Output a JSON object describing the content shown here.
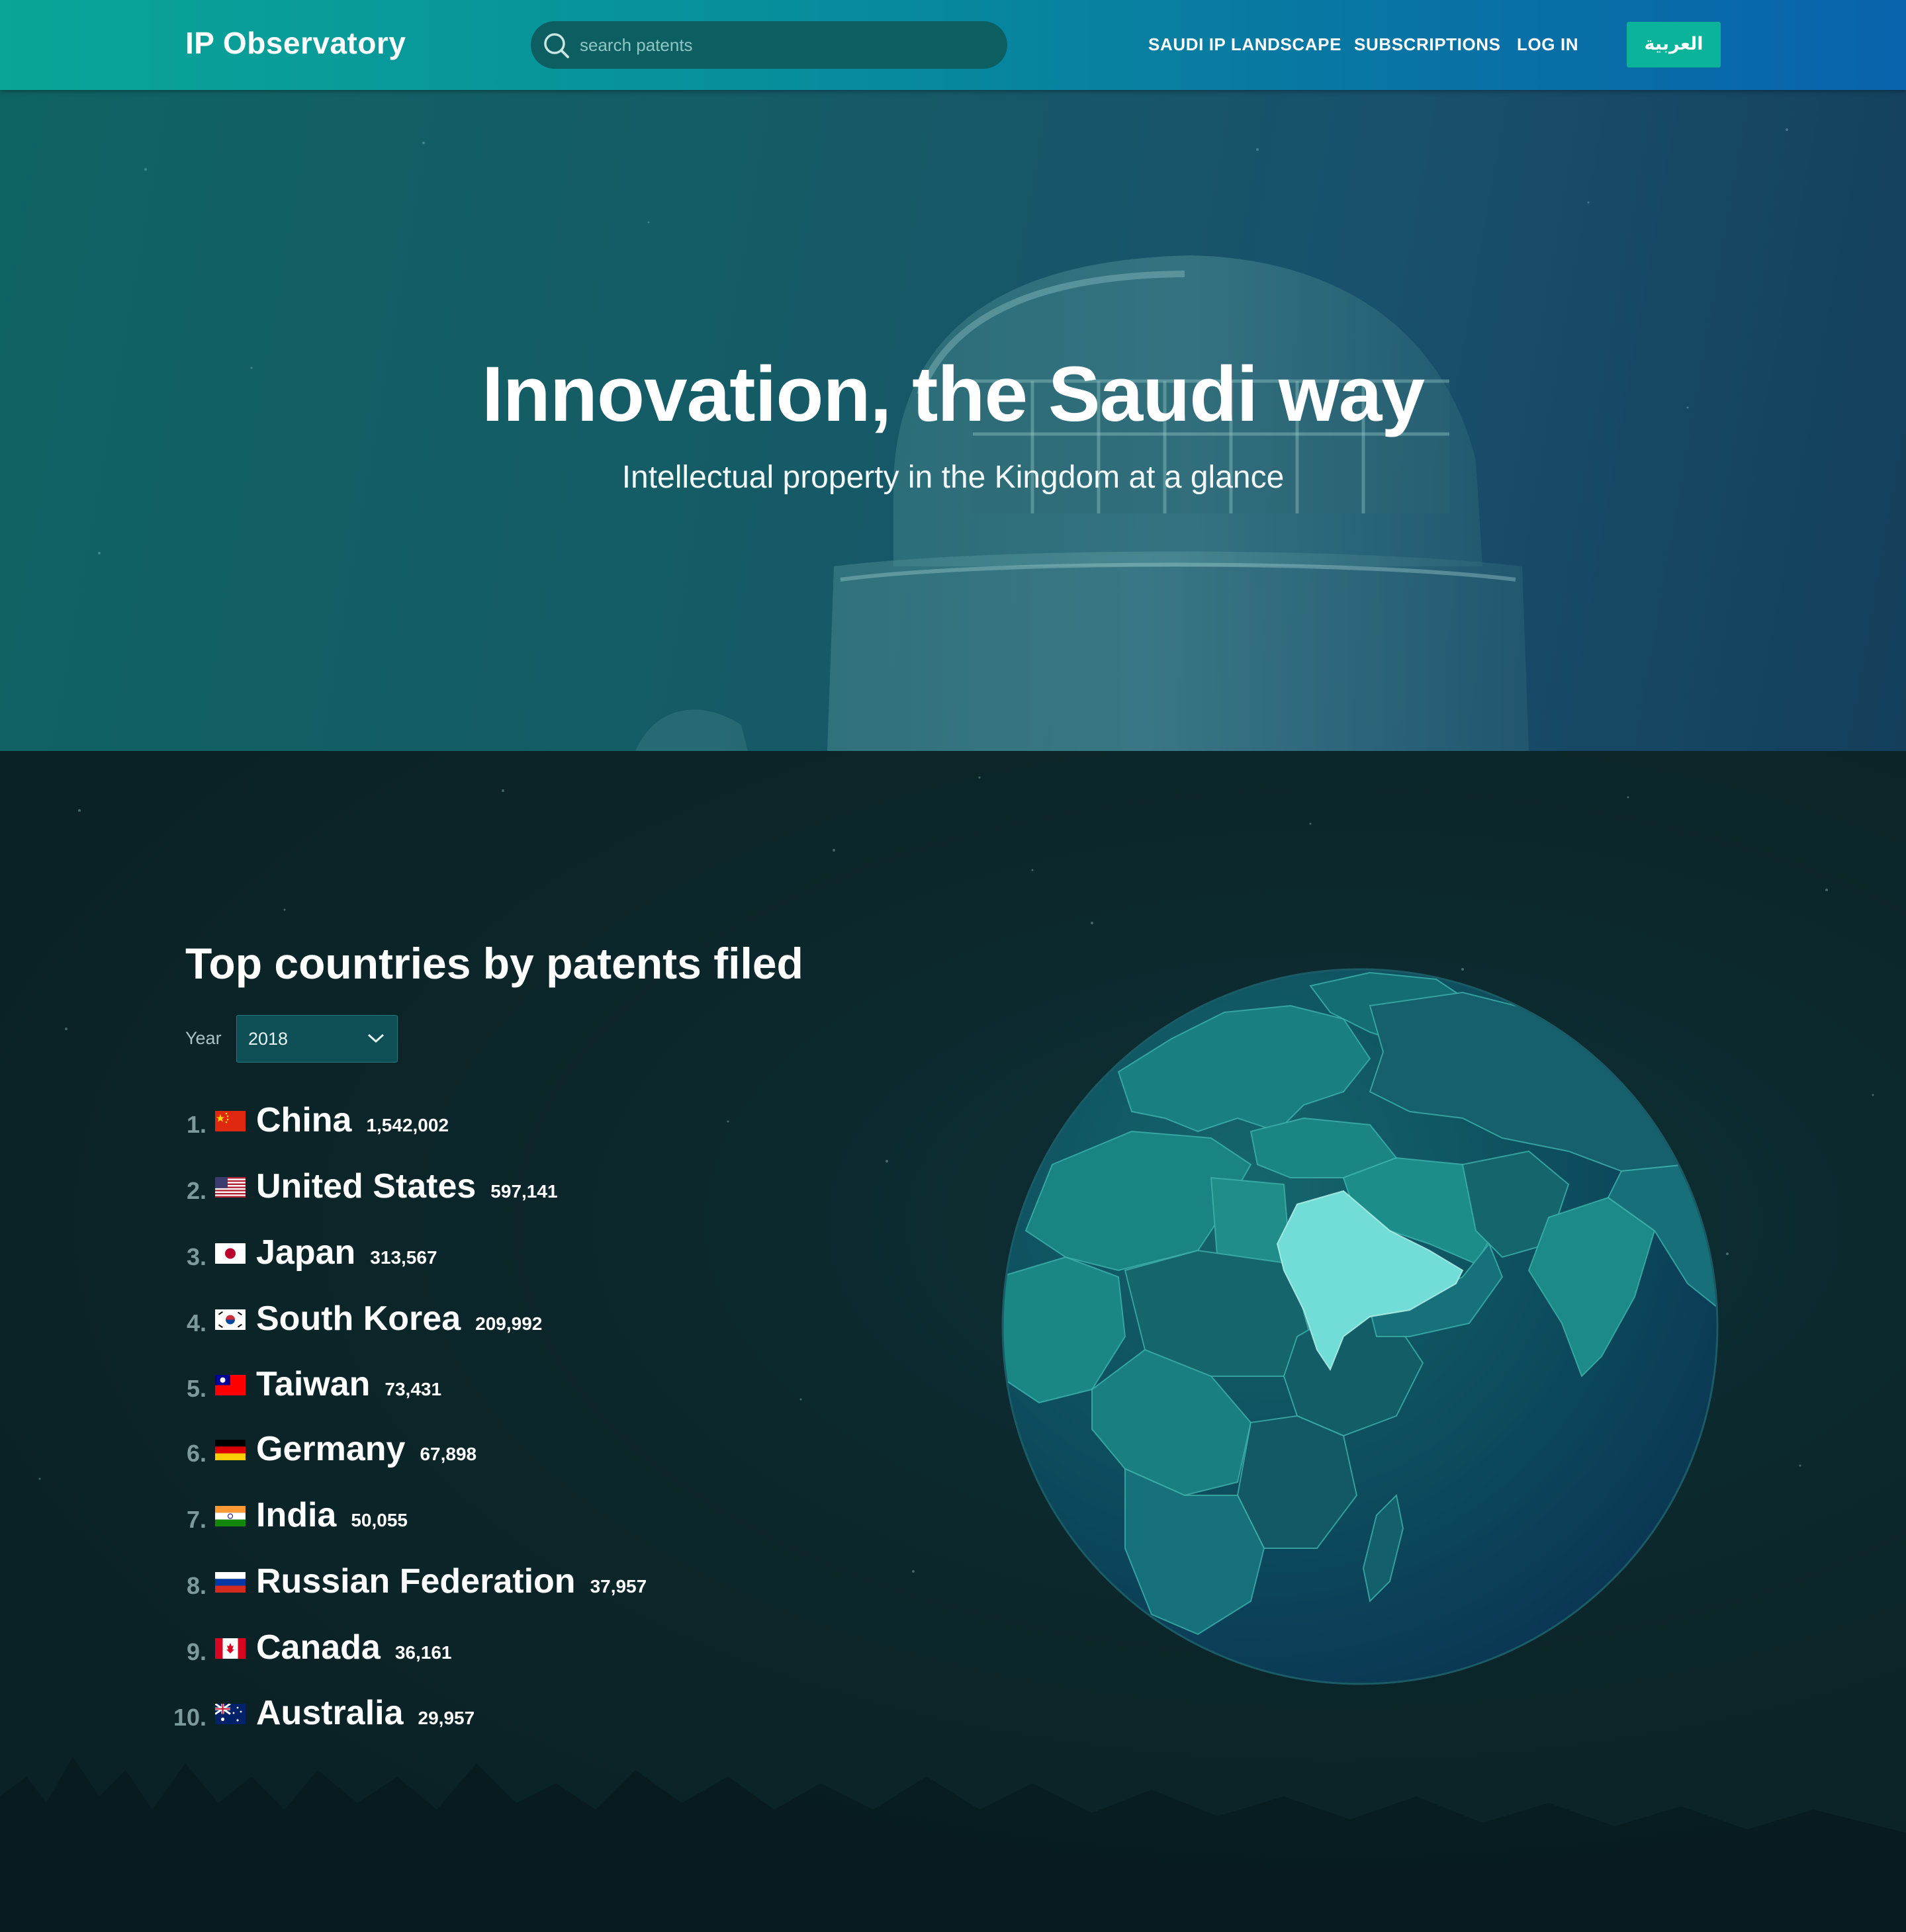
{
  "brand": {
    "name": "IP Observatory"
  },
  "search": {
    "placeholder": "search patents",
    "icon": "search-icon"
  },
  "nav": {
    "links": [
      "SAUDI IP LANDSCAPE",
      "SUBSCRIPTIONS",
      "LOG IN"
    ],
    "language_button": "العربية"
  },
  "hero": {
    "title": "Innovation, the Saudi way",
    "subtitle": "Intellectual property in the Kingdom at a glance"
  },
  "ranking": {
    "title": "Top countries by patents filed",
    "year_label": "Year",
    "year_value": "2018",
    "items": [
      {
        "rank": "1.",
        "country": "China",
        "count": "1,542,002",
        "flag": "cn-flag-icon"
      },
      {
        "rank": "2.",
        "country": "United States",
        "count": "597,141",
        "flag": "us-flag-icon"
      },
      {
        "rank": "3.",
        "country": "Japan",
        "count": "313,567",
        "flag": "jp-flag-icon"
      },
      {
        "rank": "4.",
        "country": "South Korea",
        "count": "209,992",
        "flag": "kr-flag-icon"
      },
      {
        "rank": "5.",
        "country": "Taiwan",
        "count": "73,431",
        "flag": "tw-flag-icon"
      },
      {
        "rank": "6.",
        "country": "Germany",
        "count": "67,898",
        "flag": "de-flag-icon"
      },
      {
        "rank": "7.",
        "country": "India",
        "count": "50,055",
        "flag": "in-flag-icon"
      },
      {
        "rank": "8.",
        "country": "Russian Federation",
        "count": "37,957",
        "flag": "ru-flag-icon"
      },
      {
        "rank": "9.",
        "country": "Canada",
        "count": "36,161",
        "flag": "ca-flag-icon"
      },
      {
        "rank": "10.",
        "country": "Australia",
        "count": "29,957",
        "flag": "au-flag-icon"
      }
    ]
  },
  "globe": {
    "highlighted_country": "Saudi Arabia",
    "icon": "globe-map"
  },
  "colors": {
    "header_start": "#0aa597",
    "header_end": "#0963ad",
    "accent_button": "#0ab39a",
    "highlight": "#72dcd6"
  }
}
